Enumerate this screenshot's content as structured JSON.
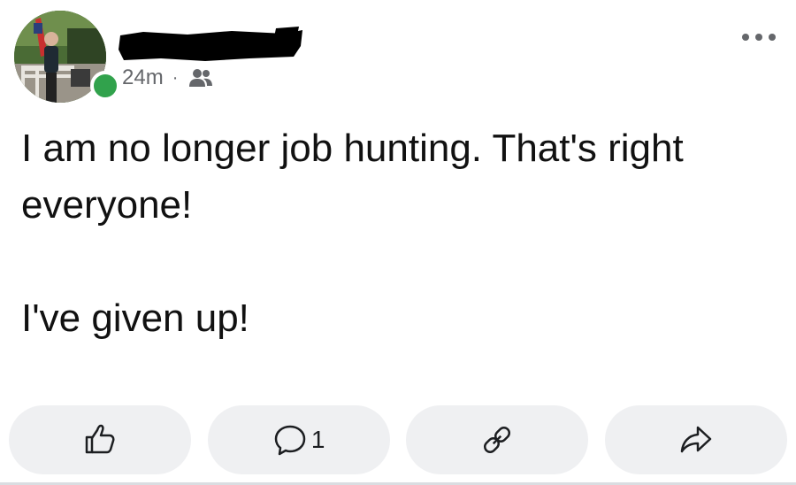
{
  "post": {
    "timestamp": "24m",
    "separator": "·",
    "audience_icon": "friends-icon",
    "author_online": true,
    "author_name_redacted": true,
    "paragraphs": [
      "I am no longer job hunting. That's right everyone!",
      "I've given up!"
    ]
  },
  "actions": [
    {
      "icon": "thumbs-up-icon",
      "label": ""
    },
    {
      "icon": "comment-icon",
      "count": "1"
    },
    {
      "icon": "link-icon",
      "label": ""
    },
    {
      "icon": "share-icon",
      "label": ""
    }
  ],
  "colors": {
    "online": "#31a24c",
    "meta_text": "#65676b",
    "button_bg": "#eff0f2",
    "redaction": "#000000"
  }
}
